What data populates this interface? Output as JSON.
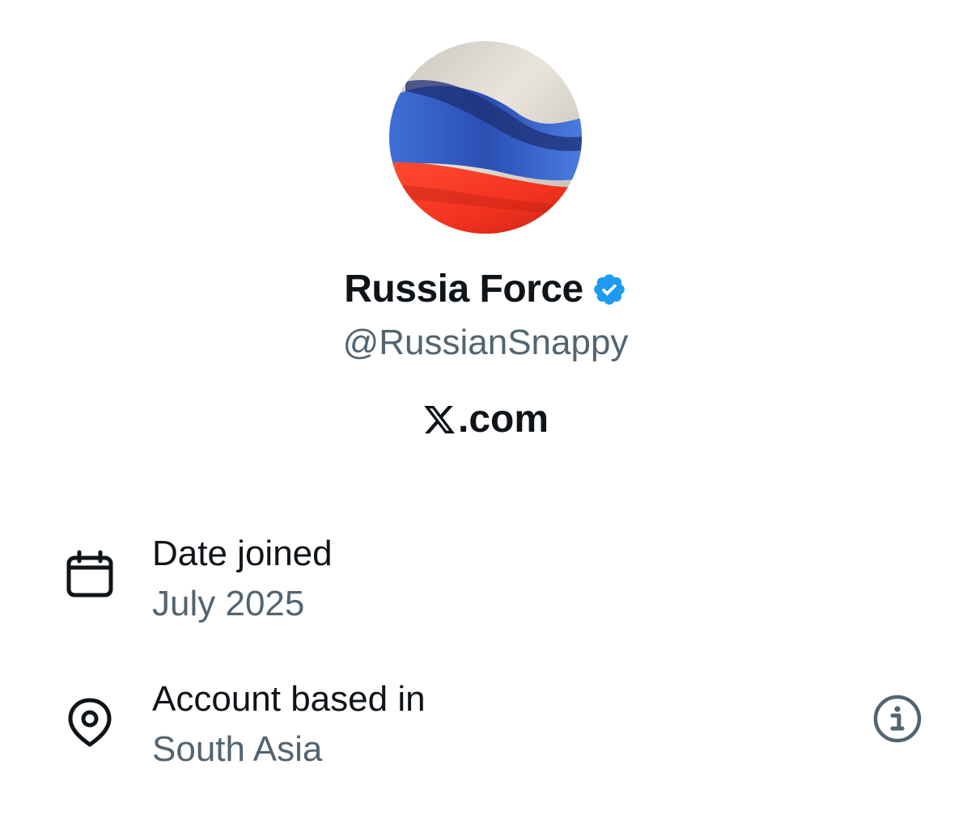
{
  "profile": {
    "display_name": "Russia Force",
    "handle": "@RussianSnappy",
    "verified": true,
    "verified_color": "#1d9bf0",
    "avatar": "russian-flag-photo"
  },
  "site": {
    "label": ".com",
    "logo": "x-logo"
  },
  "details": {
    "date_joined": {
      "title": "Date joined",
      "value": "July 2025",
      "icon": "calendar-icon"
    },
    "account_based_in": {
      "title": "Account based in",
      "value": "South Asia",
      "icon": "location-pin-icon",
      "info_icon": "info-icon"
    }
  },
  "colors": {
    "primary_text": "#0f1419",
    "secondary_text": "#536471",
    "accent": "#1d9bf0",
    "background": "#ffffff"
  }
}
